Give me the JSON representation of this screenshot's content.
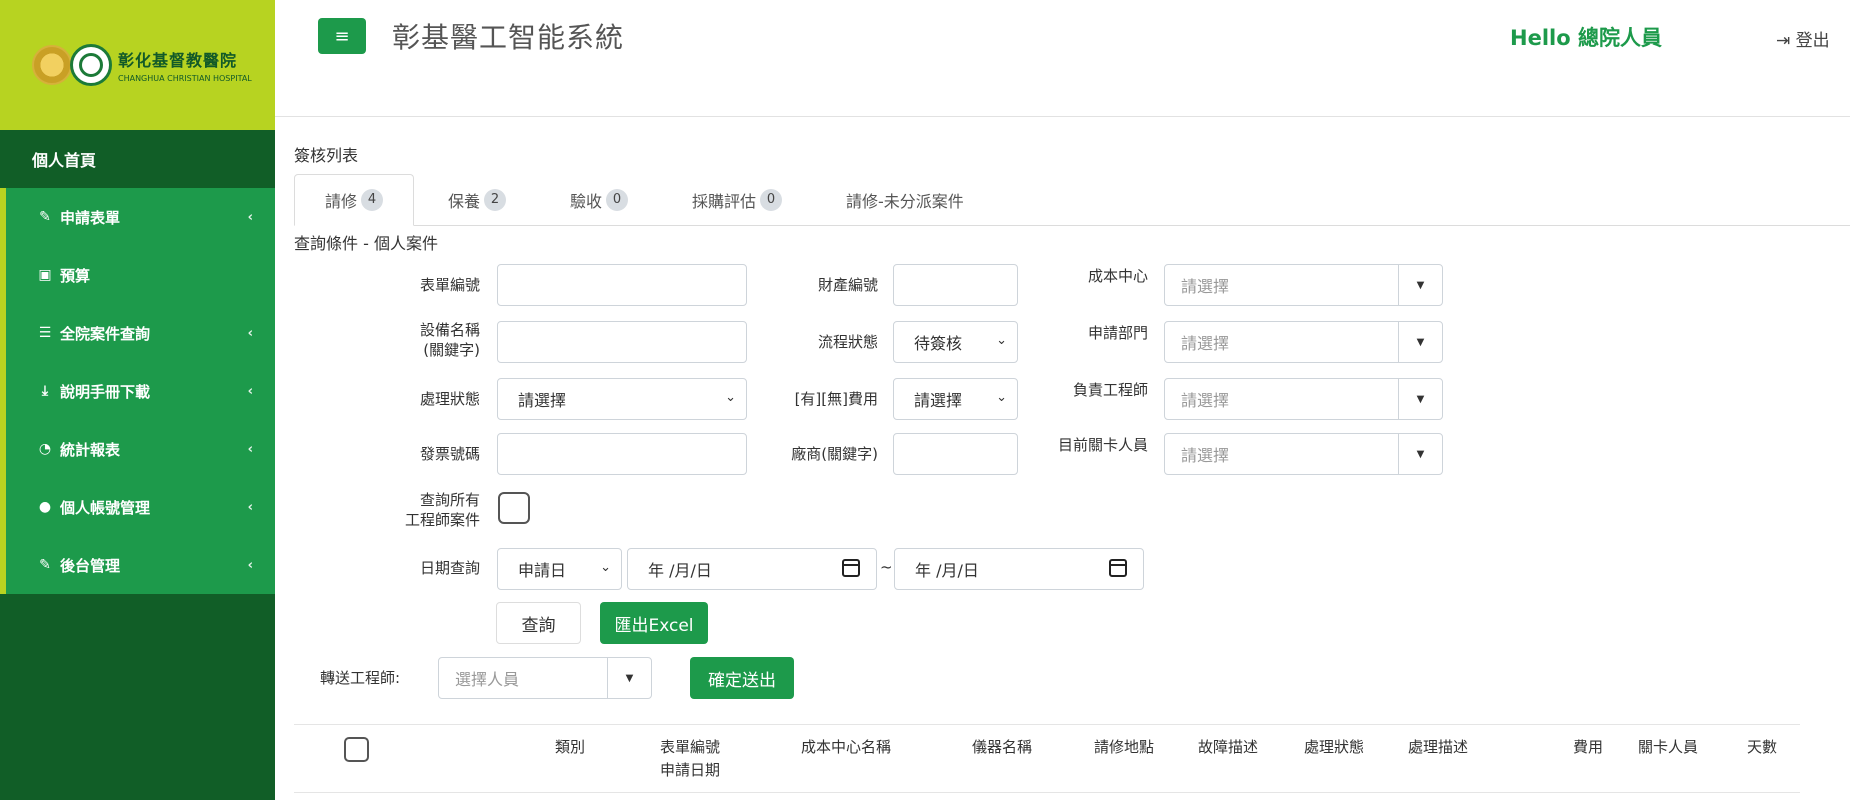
{
  "sidebar": {
    "logo": {
      "name_cn": "彰化基督教醫院",
      "name_en": "CHANGHUA CHRISTIAN HOSPITAL"
    },
    "home": "個人首頁",
    "items": [
      {
        "label": "申請表單",
        "icon": "edit-icon",
        "has_submenu": true
      },
      {
        "label": "預算",
        "icon": "money-icon",
        "has_submenu": false
      },
      {
        "label": "全院案件查詢",
        "icon": "list-icon",
        "has_submenu": true
      },
      {
        "label": "說明手冊下載",
        "icon": "download-icon",
        "has_submenu": true
      },
      {
        "label": "統計報表",
        "icon": "dashboard-icon",
        "has_submenu": true
      },
      {
        "label": "個人帳號管理",
        "icon": "user-icon",
        "has_submenu": true
      },
      {
        "label": "後台管理",
        "icon": "edit-icon",
        "has_submenu": true
      }
    ]
  },
  "header": {
    "title": "彰基醫工智能系統",
    "greeting": "Hello 總院人員",
    "logout": "登出"
  },
  "section": {
    "title": "簽核列表",
    "tabs": [
      {
        "label": "請修",
        "count": "4",
        "active": true
      },
      {
        "label": "保養",
        "count": "2",
        "active": false
      },
      {
        "label": "驗收",
        "count": "0",
        "active": false
      },
      {
        "label": "採購評估",
        "count": "0",
        "active": false
      },
      {
        "label": "請修-未分派案件",
        "count": null,
        "active": false
      }
    ]
  },
  "query": {
    "title": "查詢條件 - 個人案件",
    "form_no_label": "表單編號",
    "asset_no_label": "財產編號",
    "cost_center_label": "成本中心",
    "cost_center_placeholder": "請選擇",
    "device_name_label_1": "設備名稱",
    "device_name_label_2": "(關鍵字)",
    "flow_status_label": "流程狀態",
    "flow_status_value": "待簽核",
    "dept_label": "申請部門",
    "dept_placeholder": "請選擇",
    "process_status_label": "處理狀態",
    "process_status_value": "請選擇",
    "fee_label": "[有][無]費用",
    "fee_value": "請選擇",
    "engineer_label": "負責工程師",
    "engineer_placeholder": "請選擇",
    "invoice_label": "發票號碼",
    "vendor_label": "廠商(關鍵字)",
    "checkpoint_label": "目前關卡人員",
    "checkpoint_placeholder": "請選擇",
    "all_engineers_label_1": "查詢所有",
    "all_engineers_label_2": "工程師案件",
    "date_label": "日期查詢",
    "date_type_value": "申請日",
    "date_from": "年 /月/日",
    "date_separator": "~",
    "date_to": "年 /月/日",
    "search_button": "查詢",
    "export_button": "匯出Excel"
  },
  "transfer": {
    "label": "轉送工程師:",
    "placeholder": "選擇人員",
    "submit_button": "確定送出"
  },
  "table": {
    "headers": {
      "type": "類別",
      "form_no": "表單編號",
      "apply_date": "申請日期",
      "cost_center_name": "成本中心名稱",
      "instrument": "儀器名稱",
      "location": "請修地點",
      "fault": "故障描述",
      "status": "處理狀態",
      "process_desc": "處理描述",
      "cost": "費用",
      "checkpoint": "關卡人員",
      "days": "天數"
    }
  },
  "colors": {
    "brand_green": "#1d9a4b",
    "dark_green": "#115e27",
    "lime": "#b7d321"
  }
}
